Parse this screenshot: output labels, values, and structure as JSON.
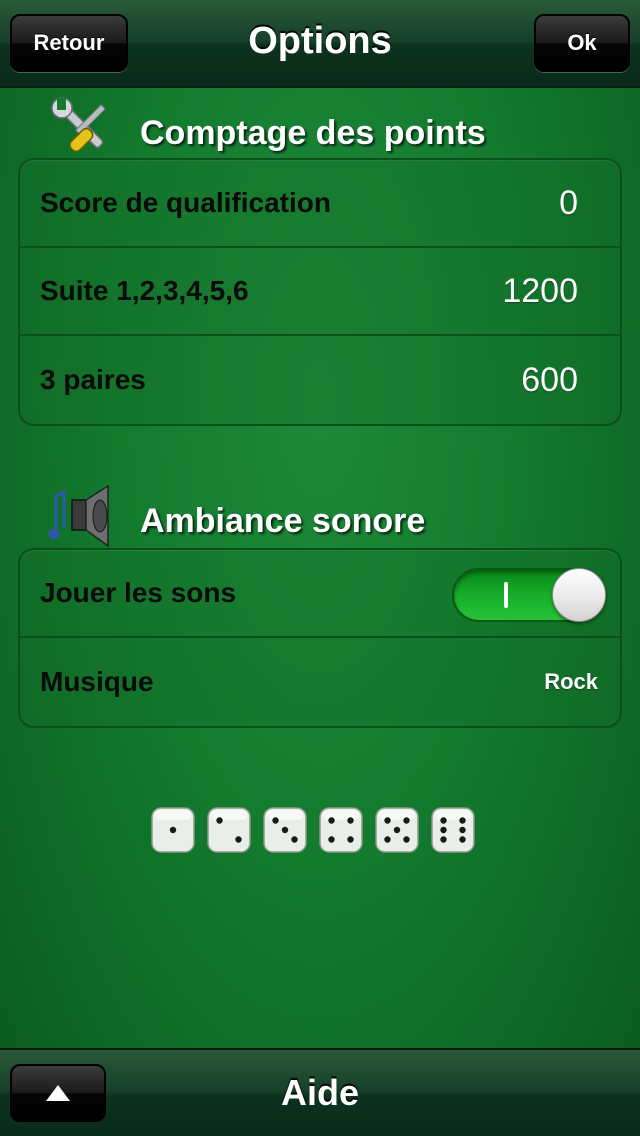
{
  "navbar": {
    "title": "Options",
    "back_label": "Retour",
    "ok_label": "Ok"
  },
  "scoring": {
    "title": "Comptage des points",
    "icon": "tools-icon",
    "rows": [
      {
        "label": "Score de qualification",
        "value": "0"
      },
      {
        "label": "Suite 1,2,3,4,5,6",
        "value": "1200"
      },
      {
        "label": "3 paires",
        "value": "600"
      }
    ]
  },
  "sound": {
    "title": "Ambiance sonore",
    "icon": "speaker-music-icon",
    "play_sounds_label": "Jouer les sons",
    "play_sounds_on": true,
    "toggle_on_mark": "I",
    "music_label": "Musique",
    "music_value": "Rock"
  },
  "dice": [
    1,
    2,
    3,
    4,
    5,
    6
  ],
  "bottombar": {
    "title": "Aide",
    "up_icon": "up-arrow-icon"
  },
  "colors": {
    "felt": "#137a2e",
    "toggle_on": "#18b02a"
  }
}
